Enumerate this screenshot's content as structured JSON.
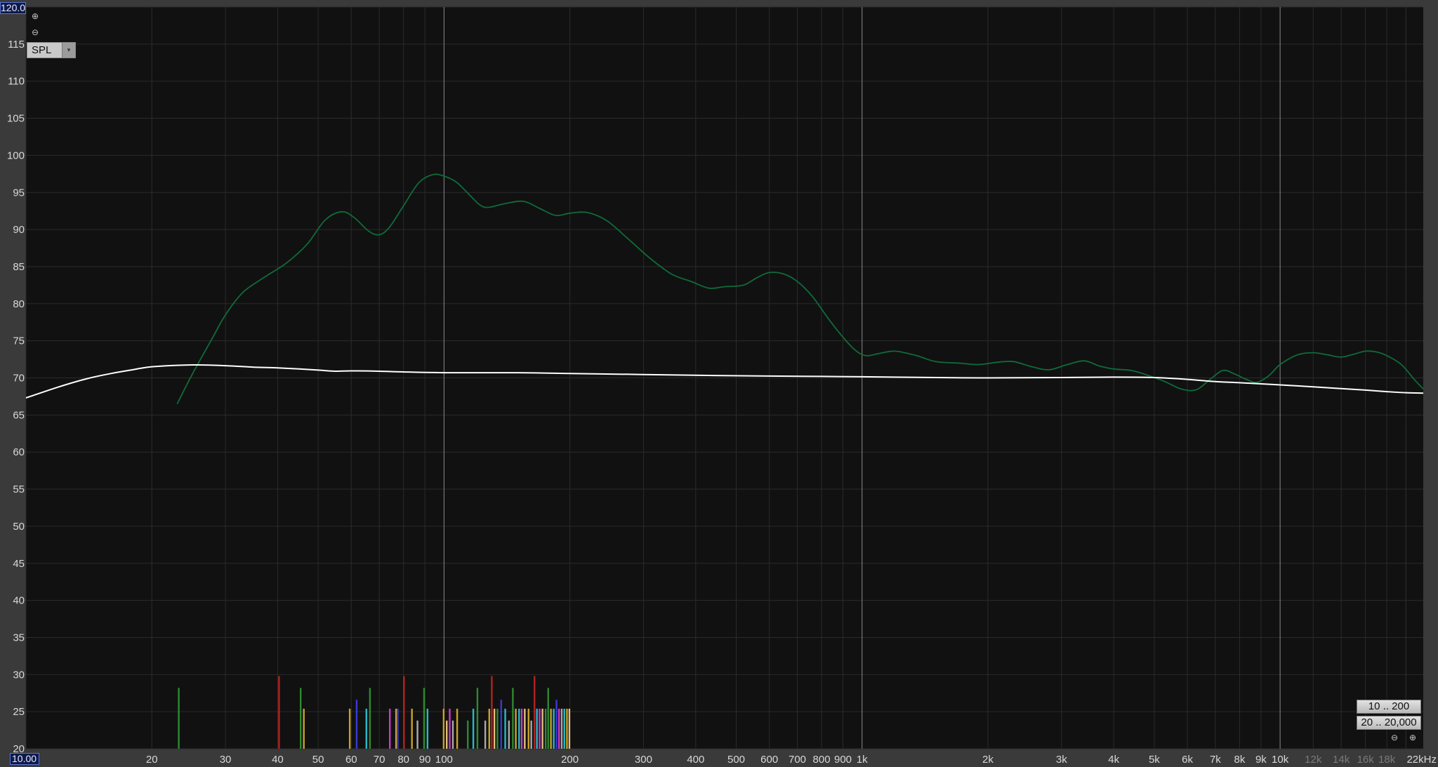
{
  "colors": {
    "background": "#3a3a3a",
    "plot_background": "#111111",
    "grid_minor": "#2b2b2b",
    "grid_major": "#8a8a8a",
    "tick_text": "#d8d8d8",
    "measured_trace": "#0f6b3a",
    "target_trace": "#ffffff"
  },
  "controls": {
    "zoom_in_icon": "⊕",
    "zoom_out_icon": "⊖",
    "spl_select": {
      "label": "SPL",
      "arrow_icon": "▾"
    },
    "range_buttons": [
      "10 .. 200",
      "20 .. 20,000"
    ],
    "h_zoom_out_icon": "⊖",
    "h_zoom_in_icon": "⊕",
    "y_max_value": "120.00",
    "x_min_value": "10.00"
  },
  "chart_data": {
    "type": "line",
    "x_scale": "log",
    "xlim": [
      10,
      22000
    ],
    "ylim": [
      20,
      120
    ],
    "grid": true,
    "y_ticks": [
      20,
      25,
      30,
      35,
      40,
      45,
      50,
      55,
      60,
      65,
      70,
      75,
      80,
      85,
      90,
      95,
      100,
      105,
      110,
      115
    ],
    "x_ticks": [
      {
        "v": 20,
        "label": "20"
      },
      {
        "v": 30,
        "label": "30"
      },
      {
        "v": 40,
        "label": "40"
      },
      {
        "v": 50,
        "label": "50"
      },
      {
        "v": 60,
        "label": "60"
      },
      {
        "v": 70,
        "label": "70"
      },
      {
        "v": 80,
        "label": "80"
      },
      {
        "v": 90,
        "label": "90"
      },
      {
        "v": 100,
        "label": "100"
      },
      {
        "v": 200,
        "label": "200"
      },
      {
        "v": 300,
        "label": "300"
      },
      {
        "v": 400,
        "label": "400"
      },
      {
        "v": 500,
        "label": "500"
      },
      {
        "v": 600,
        "label": "600"
      },
      {
        "v": 700,
        "label": "700"
      },
      {
        "v": 800,
        "label": "800"
      },
      {
        "v": 900,
        "label": "900"
      },
      {
        "v": 1000,
        "label": "1k"
      },
      {
        "v": 2000,
        "label": "2k"
      },
      {
        "v": 3000,
        "label": "3k"
      },
      {
        "v": 4000,
        "label": "4k"
      },
      {
        "v": 5000,
        "label": "5k"
      },
      {
        "v": 6000,
        "label": "6k"
      },
      {
        "v": 7000,
        "label": "7k"
      },
      {
        "v": 8000,
        "label": "8k"
      },
      {
        "v": 9000,
        "label": "9k"
      },
      {
        "v": 10000,
        "label": "10k"
      },
      {
        "v": 12000,
        "label": "12k",
        "dim": true
      },
      {
        "v": 14000,
        "label": "14k",
        "dim": true
      },
      {
        "v": 16000,
        "label": "16k",
        "dim": true
      },
      {
        "v": 18000,
        "label": "18k",
        "dim": true
      },
      {
        "v": 22000,
        "label": "22kHz"
      }
    ],
    "series": [
      {
        "color": "#0f6b3a",
        "points": [
          [
            23,
            66.5
          ],
          [
            25,
            70.5
          ],
          [
            28,
            75.5
          ],
          [
            30,
            78.5
          ],
          [
            33,
            81.5
          ],
          [
            37,
            83.5
          ],
          [
            42,
            85.5
          ],
          [
            47,
            88
          ],
          [
            52,
            91.3
          ],
          [
            57,
            92.4
          ],
          [
            61,
            91.6
          ],
          [
            66,
            89.8
          ],
          [
            70,
            89.3
          ],
          [
            74,
            90.3
          ],
          [
            80,
            93.2
          ],
          [
            87,
            96.3
          ],
          [
            94,
            97.4
          ],
          [
            100,
            97.2
          ],
          [
            107,
            96.4
          ],
          [
            114,
            94.9
          ],
          [
            122,
            93.3
          ],
          [
            128,
            93.0
          ],
          [
            140,
            93.5
          ],
          [
            155,
            93.8
          ],
          [
            170,
            92.8
          ],
          [
            185,
            91.9
          ],
          [
            200,
            92.2
          ],
          [
            220,
            92.3
          ],
          [
            245,
            91.2
          ],
          [
            275,
            88.8
          ],
          [
            310,
            86.2
          ],
          [
            350,
            84.0
          ],
          [
            390,
            83.0
          ],
          [
            430,
            82.1
          ],
          [
            470,
            82.3
          ],
          [
            520,
            82.5
          ],
          [
            560,
            83.5
          ],
          [
            600,
            84.2
          ],
          [
            650,
            84.0
          ],
          [
            700,
            83.0
          ],
          [
            760,
            81.0
          ],
          [
            830,
            78.0
          ],
          [
            900,
            75.5
          ],
          [
            960,
            73.8
          ],
          [
            1020,
            73.0
          ],
          [
            1100,
            73.3
          ],
          [
            1200,
            73.6
          ],
          [
            1350,
            73.0
          ],
          [
            1500,
            72.2
          ],
          [
            1700,
            72.0
          ],
          [
            1900,
            71.8
          ],
          [
            2100,
            72.1
          ],
          [
            2300,
            72.2
          ],
          [
            2550,
            71.5
          ],
          [
            2800,
            71.1
          ],
          [
            3100,
            71.8
          ],
          [
            3400,
            72.3
          ],
          [
            3700,
            71.6
          ],
          [
            4000,
            71.2
          ],
          [
            4400,
            71.0
          ],
          [
            4800,
            70.4
          ],
          [
            5300,
            69.5
          ],
          [
            5800,
            68.5
          ],
          [
            6300,
            68.4
          ],
          [
            6800,
            69.8
          ],
          [
            7300,
            71.0
          ],
          [
            7800,
            70.5
          ],
          [
            8300,
            69.8
          ],
          [
            8800,
            69.4
          ],
          [
            9400,
            70.3
          ],
          [
            10000,
            71.8
          ],
          [
            11000,
            73.1
          ],
          [
            12000,
            73.4
          ],
          [
            13000,
            73.1
          ],
          [
            14000,
            72.8
          ],
          [
            15000,
            73.2
          ],
          [
            16000,
            73.6
          ],
          [
            17000,
            73.5
          ],
          [
            18000,
            73.0
          ],
          [
            19500,
            71.8
          ],
          [
            21000,
            69.7
          ],
          [
            22000,
            68.5
          ]
        ]
      },
      {
        "color": "#ffffff",
        "points": [
          [
            10,
            67.3
          ],
          [
            12,
            68.8
          ],
          [
            14,
            69.9
          ],
          [
            16,
            70.6
          ],
          [
            18,
            71.1
          ],
          [
            20,
            71.5
          ],
          [
            25,
            71.75
          ],
          [
            30,
            71.65
          ],
          [
            35,
            71.45
          ],
          [
            40,
            71.35
          ],
          [
            45,
            71.2
          ],
          [
            50,
            71.05
          ],
          [
            55,
            70.9
          ],
          [
            60,
            70.95
          ],
          [
            70,
            70.9
          ],
          [
            80,
            70.8
          ],
          [
            100,
            70.7
          ],
          [
            150,
            70.7
          ],
          [
            200,
            70.6
          ],
          [
            300,
            70.45
          ],
          [
            400,
            70.35
          ],
          [
            600,
            70.25
          ],
          [
            800,
            70.2
          ],
          [
            1000,
            70.15
          ],
          [
            1500,
            70.05
          ],
          [
            2000,
            70.0
          ],
          [
            3000,
            70.05
          ],
          [
            4000,
            70.1
          ],
          [
            5000,
            70.05
          ],
          [
            6000,
            69.8
          ],
          [
            7000,
            69.5
          ],
          [
            8000,
            69.35
          ],
          [
            9000,
            69.2
          ],
          [
            10000,
            69.05
          ],
          [
            12000,
            68.8
          ],
          [
            14000,
            68.55
          ],
          [
            16000,
            68.35
          ],
          [
            18000,
            68.15
          ],
          [
            20000,
            68.0
          ],
          [
            22000,
            67.95
          ]
        ]
      }
    ],
    "impulses": [
      {
        "f": 23.2,
        "y": 28.2,
        "c": "#2e8a2e"
      },
      {
        "f": 40.3,
        "y": 29.8,
        "c": "#b22222"
      },
      {
        "f": 45.4,
        "y": 28.2,
        "c": "#2e8a2e"
      },
      {
        "f": 46.2,
        "y": 25.4,
        "c": "#c9a227"
      },
      {
        "f": 59.5,
        "y": 25.4,
        "c": "#c9a227"
      },
      {
        "f": 61.8,
        "y": 26.6,
        "c": "#3a3ad0"
      },
      {
        "f": 65.2,
        "y": 25.4,
        "c": "#29b8c8"
      },
      {
        "f": 66.5,
        "y": 28.2,
        "c": "#2e8a2e"
      },
      {
        "f": 74.2,
        "y": 25.4,
        "c": "#c83cc8"
      },
      {
        "f": 76.8,
        "y": 25.4,
        "c": "#c9a227"
      },
      {
        "f": 77.5,
        "y": 25.4,
        "c": "#3a3ad0"
      },
      {
        "f": 80.2,
        "y": 29.8,
        "c": "#b22222"
      },
      {
        "f": 83.8,
        "y": 25.4,
        "c": "#c9a227"
      },
      {
        "f": 86.4,
        "y": 23.8,
        "c": "#aaaaaa"
      },
      {
        "f": 89.6,
        "y": 28.2,
        "c": "#2e8a2e"
      },
      {
        "f": 91.3,
        "y": 25.4,
        "c": "#29b8c8"
      },
      {
        "f": 99.8,
        "y": 25.4,
        "c": "#c9a227"
      },
      {
        "f": 101.5,
        "y": 23.8,
        "c": "#e0c080"
      },
      {
        "f": 103.2,
        "y": 25.4,
        "c": "#c83cc8"
      },
      {
        "f": 105.0,
        "y": 23.8,
        "c": "#aaaaaa"
      },
      {
        "f": 107.5,
        "y": 25.4,
        "c": "#c9a227"
      },
      {
        "f": 114.0,
        "y": 23.8,
        "c": "#2e8a2e"
      },
      {
        "f": 117.5,
        "y": 25.4,
        "c": "#29b8c8"
      },
      {
        "f": 120.2,
        "y": 28.2,
        "c": "#2e8a2e"
      },
      {
        "f": 125.5,
        "y": 23.8,
        "c": "#aaaaaa"
      },
      {
        "f": 128.3,
        "y": 25.4,
        "c": "#c9a227"
      },
      {
        "f": 130.1,
        "y": 29.8,
        "c": "#b22222"
      },
      {
        "f": 132.0,
        "y": 25.4,
        "c": "#e0c080"
      },
      {
        "f": 134.2,
        "y": 25.4,
        "c": "#2e8a2e"
      },
      {
        "f": 137.0,
        "y": 26.6,
        "c": "#3a3ad0"
      },
      {
        "f": 140.1,
        "y": 25.4,
        "c": "#29b8c8"
      },
      {
        "f": 143.0,
        "y": 23.8,
        "c": "#aaaaaa"
      },
      {
        "f": 146.1,
        "y": 28.2,
        "c": "#2e8a2e"
      },
      {
        "f": 148.5,
        "y": 25.4,
        "c": "#c9a227"
      },
      {
        "f": 151.2,
        "y": 25.4,
        "c": "#29b8c8"
      },
      {
        "f": 153.4,
        "y": 25.4,
        "c": "#c83cc8"
      },
      {
        "f": 156.0,
        "y": 25.4,
        "c": "#e0c080"
      },
      {
        "f": 159.3,
        "y": 25.4,
        "c": "#c9a227"
      },
      {
        "f": 161.7,
        "y": 23.8,
        "c": "#aaaaaa"
      },
      {
        "f": 164.6,
        "y": 29.8,
        "c": "#b22222"
      },
      {
        "f": 166.8,
        "y": 25.4,
        "c": "#29b8c8"
      },
      {
        "f": 169.3,
        "y": 25.4,
        "c": "#c83cc8"
      },
      {
        "f": 172.0,
        "y": 25.4,
        "c": "#e0c080"
      },
      {
        "f": 175.0,
        "y": 25.4,
        "c": "#2e8a2e"
      },
      {
        "f": 177.5,
        "y": 28.2,
        "c": "#2e8a2e"
      },
      {
        "f": 180.2,
        "y": 25.4,
        "c": "#c9a227"
      },
      {
        "f": 183.0,
        "y": 25.4,
        "c": "#29b8c8"
      },
      {
        "f": 185.8,
        "y": 26.6,
        "c": "#3a3ad0"
      },
      {
        "f": 188.4,
        "y": 25.4,
        "c": "#c83cc8"
      },
      {
        "f": 191.2,
        "y": 25.4,
        "c": "#aaaaaa"
      },
      {
        "f": 194.0,
        "y": 25.4,
        "c": "#29b8c8"
      },
      {
        "f": 196.8,
        "y": 25.4,
        "c": "#c9a227"
      },
      {
        "f": 199.5,
        "y": 25.4,
        "c": "#e0c080"
      }
    ]
  }
}
